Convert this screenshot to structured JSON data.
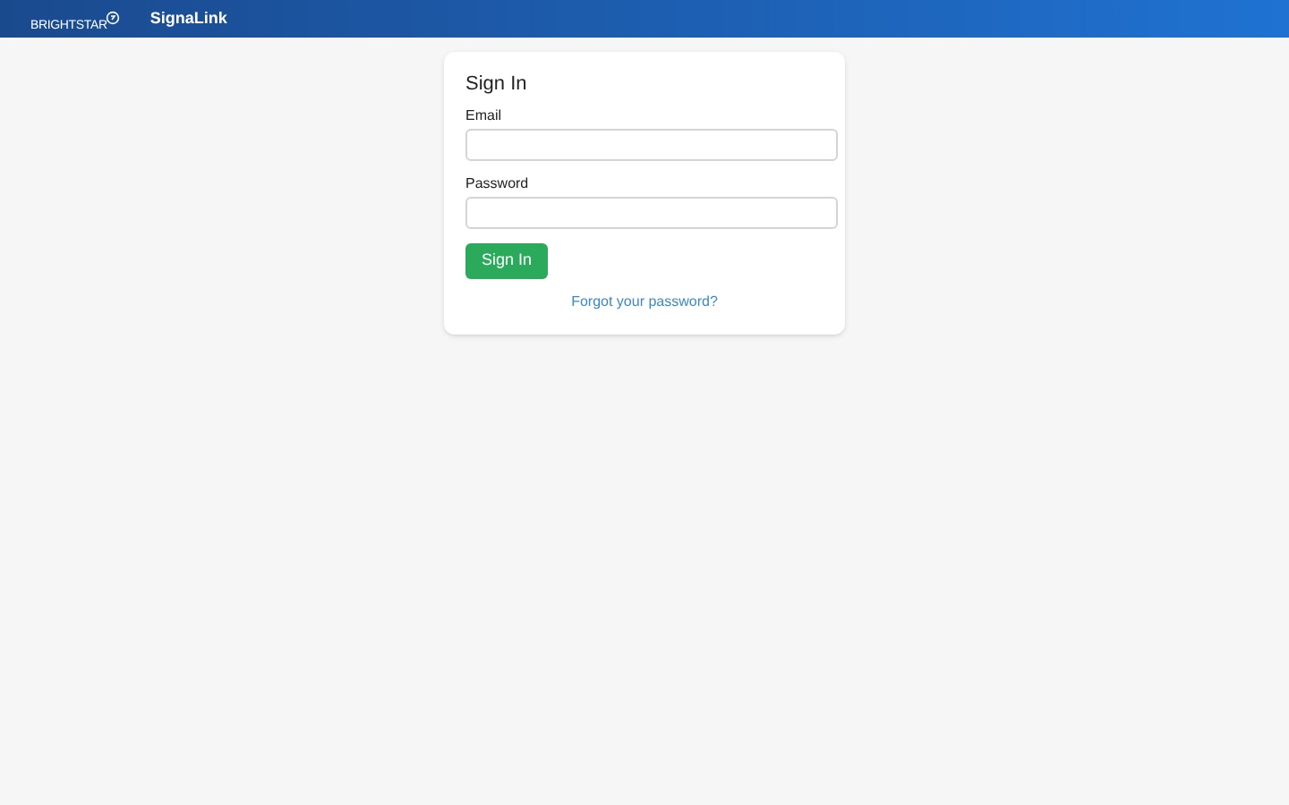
{
  "header": {
    "logo": "BRIGHTSTAR",
    "app_name": "SignaLink"
  },
  "form": {
    "title": "Sign In",
    "fields": [
      {
        "label": "Email"
      },
      {
        "label": "Password"
      }
    ],
    "submit": "Sign In",
    "forgot_link": "Forgot your password?"
  }
}
